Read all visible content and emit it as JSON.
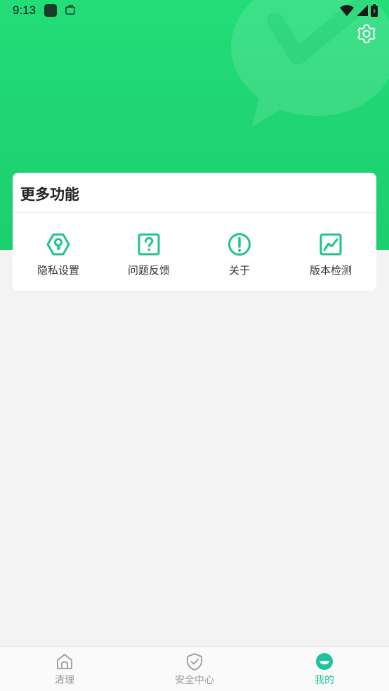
{
  "status_bar": {
    "time": "9:13"
  },
  "header": {
    "settings_icon": "gear-icon",
    "accent_color": "#22dd78"
  },
  "card": {
    "title": "更多功能",
    "items": [
      {
        "label": "隐私设置",
        "icon": "key-hexagon-icon"
      },
      {
        "label": "问题反馈",
        "icon": "question-icon"
      },
      {
        "label": "关于",
        "icon": "exclamation-circle-icon"
      },
      {
        "label": "版本检测",
        "icon": "chart-line-icon"
      }
    ],
    "icon_color": "#1ec48f"
  },
  "bottom_nav": {
    "items": [
      {
        "label": "清理",
        "icon": "home-icon",
        "active": false
      },
      {
        "label": "安全中心",
        "icon": "shield-check-icon",
        "active": false
      },
      {
        "label": "我的",
        "icon": "smile-icon",
        "active": true
      }
    ],
    "active_color": "#1ec4a0"
  }
}
